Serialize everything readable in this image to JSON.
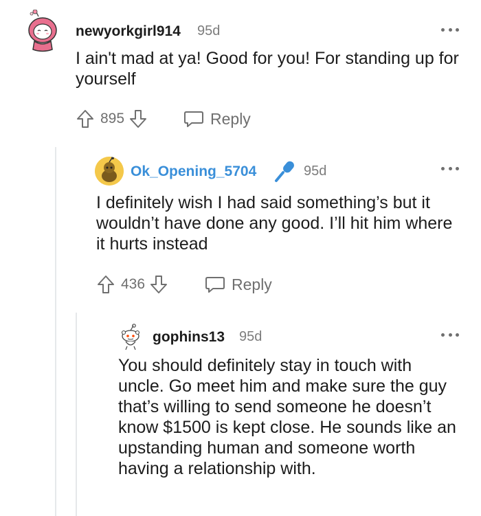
{
  "comments": [
    {
      "username": "newyorkgirl914",
      "age": "95d",
      "body": "I ain't mad at ya! Good for you! For standing up for yourself",
      "votes": "895",
      "reply_label": "Reply"
    },
    {
      "username": "Ok_Opening_5704",
      "age": "95d",
      "body": "I definitely wish I had said something’s but it wouldn’t have done any good. I’ll hit him where it hurts instead",
      "votes": "436",
      "reply_label": "Reply"
    },
    {
      "username": "gophins13",
      "age": "95d",
      "body": "You should definitely stay in touch with uncle. Go meet him and make sure the guy that’s willing to send someone he doesn’t know $1500 is kept close. He sounds like an upstanding human and someone worth having a relationship with."
    }
  ],
  "colors": {
    "op_username": "#3a8fd9",
    "meta_gray": "#7c7c7c",
    "icon_gray": "#6f6f6f",
    "thread_line": "#e6e8ea"
  },
  "icons": [
    "upvote-icon",
    "downvote-icon",
    "comment-bubble-icon",
    "microphone-icon",
    "more-options-icon"
  ]
}
